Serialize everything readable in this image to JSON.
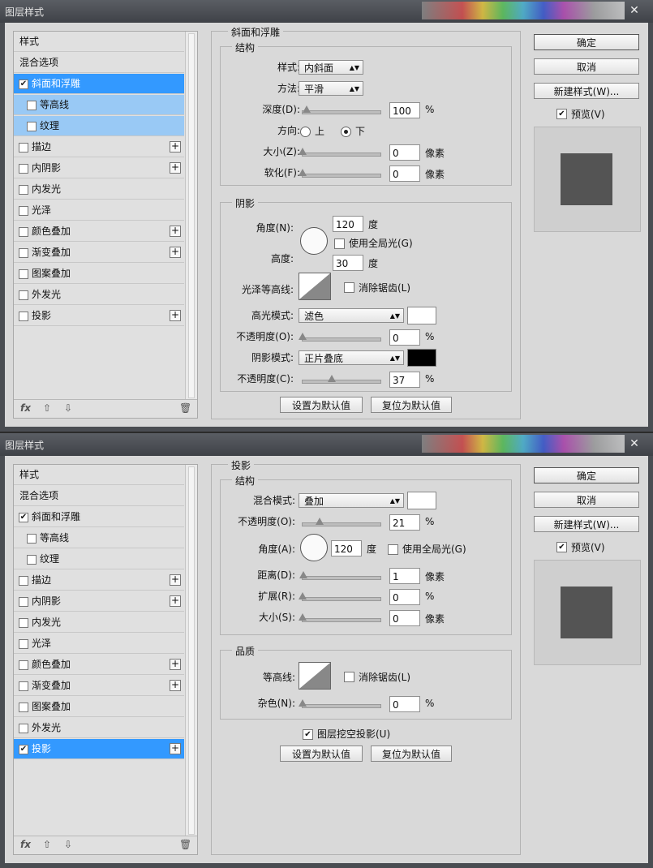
{
  "dialog1": {
    "title": "图层样式",
    "sidebar": {
      "items": [
        {
          "label": "样式"
        },
        {
          "label": "混合选项"
        },
        {
          "label": "斜面和浮雕",
          "checked": "✔"
        },
        {
          "label": "等高线"
        },
        {
          "label": "纹理"
        },
        {
          "label": "描边",
          "plus": "+"
        },
        {
          "label": "内阴影",
          "plus": "+"
        },
        {
          "label": "内发光"
        },
        {
          "label": "光泽"
        },
        {
          "label": "颜色叠加",
          "plus": "+"
        },
        {
          "label": "渐变叠加",
          "plus": "+"
        },
        {
          "label": "图案叠加"
        },
        {
          "label": "外发光"
        },
        {
          "label": "投影",
          "plus": "+"
        }
      ],
      "footer": {
        "fx": "fx",
        "up": "⇧",
        "down": "⇩",
        "trash": "🗑"
      }
    },
    "panel": {
      "title": "斜面和浮雕",
      "structure": {
        "title": "结构",
        "style_label": "样式:",
        "style_value": "内斜面",
        "method_label": "方法:",
        "method_value": "平滑",
        "depth_label": "深度(D):",
        "depth_value": "100",
        "depth_unit": "%",
        "depth_level": 0.05,
        "direction_label": "方向:",
        "dir_up": "上",
        "dir_down": "下",
        "size_label": "大小(Z):",
        "size_value": "0",
        "size_unit": "像素",
        "soften_label": "软化(F):",
        "soften_value": "0",
        "soften_unit": "像素"
      },
      "shading": {
        "title": "阴影",
        "angle_label": "角度(N):",
        "angle_value": "120",
        "angle_unit": "度",
        "global_light": "使用全局光(G)",
        "altitude_label": "高度:",
        "altitude_value": "30",
        "altitude_unit": "度",
        "gloss_label": "光泽等高线:",
        "antialias": "消除锯齿(L)",
        "highlight_label": "高光模式:",
        "highlight_mode": "滤色",
        "highlight_color": "#ffffff",
        "hl_opacity_label": "不透明度(O):",
        "hl_opacity_value": "0",
        "hl_opacity_unit": "%",
        "shadow_label": "阴影模式:",
        "shadow_mode": "正片叠底",
        "shadow_color": "#000000",
        "sh_opacity_label": "不透明度(C):",
        "sh_opacity_value": "37",
        "sh_opacity_unit": "%",
        "sh_opacity_level": 0.37
      },
      "make_default": "设置为默认值",
      "reset_default": "复位为默认值"
    },
    "buttons": {
      "ok": "确定",
      "cancel": "取消",
      "new_style": "新建样式(W)...",
      "preview": "预览(V)"
    }
  },
  "dialog2": {
    "title": "图层样式",
    "sidebar": {
      "items": [
        {
          "label": "样式"
        },
        {
          "label": "混合选项"
        },
        {
          "label": "斜面和浮雕",
          "checked": "✔"
        },
        {
          "label": "等高线"
        },
        {
          "label": "纹理"
        },
        {
          "label": "描边",
          "plus": "+"
        },
        {
          "label": "内阴影",
          "plus": "+"
        },
        {
          "label": "内发光"
        },
        {
          "label": "光泽"
        },
        {
          "label": "颜色叠加",
          "plus": "+"
        },
        {
          "label": "渐变叠加",
          "plus": "+"
        },
        {
          "label": "图案叠加"
        },
        {
          "label": "外发光"
        },
        {
          "label": "投影",
          "checked": "✔",
          "plus": "+"
        }
      ],
      "footer": {
        "fx": "fx",
        "up": "⇧",
        "down": "⇩",
        "trash": "🗑"
      }
    },
    "panel": {
      "title": "投影",
      "structure": {
        "title": "结构",
        "blend_label": "混合模式:",
        "blend_value": "叠加",
        "blend_color": "#ffffff",
        "opacity_label": "不透明度(O):",
        "opacity_value": "21",
        "opacity_unit": "%",
        "opacity_level": 0.21,
        "angle_label": "角度(A):",
        "angle_value": "120",
        "angle_unit": "度",
        "global_light": "使用全局光(G)",
        "distance_label": "距离(D):",
        "distance_value": "1",
        "distance_unit": "像素",
        "spread_label": "扩展(R):",
        "spread_value": "0",
        "spread_unit": "%",
        "size_label": "大小(S):",
        "size_value": "0",
        "size_unit": "像素"
      },
      "quality": {
        "title": "品质",
        "contour_label": "等高线:",
        "antialias": "消除锯齿(L)",
        "noise_label": "杂色(N):",
        "noise_value": "0",
        "noise_unit": "%"
      },
      "knockout": "图层挖空投影(U)",
      "make_default": "设置为默认值",
      "reset_default": "复位为默认值"
    },
    "buttons": {
      "ok": "确定",
      "cancel": "取消",
      "new_style": "新建样式(W)...",
      "preview": "预览(V)"
    }
  }
}
